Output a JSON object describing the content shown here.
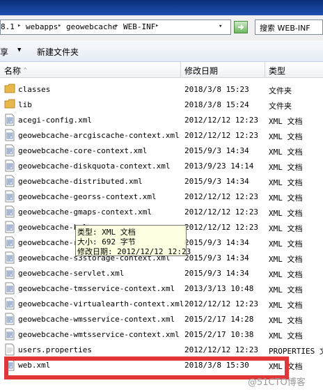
{
  "address": {
    "crumbs": [
      "8.1",
      "webapps",
      "geowebcache",
      "WEB-INF"
    ],
    "separator": "▸",
    "dropdown": "▾"
  },
  "search": {
    "placeholder": "搜索 WEB-INF"
  },
  "toolbar": {
    "share_label": "享",
    "share_caret": "▼",
    "new_folder_label": "新建文件夹"
  },
  "columns": {
    "name": "名称",
    "date": "修改日期",
    "type": "类型",
    "sort": "^"
  },
  "files": [
    {
      "name": "classes",
      "date": "2018/3/8 15:23",
      "type": "文件夹",
      "icon": "folder-icon"
    },
    {
      "name": "lib",
      "date": "2018/3/8 15:24",
      "type": "文件夹",
      "icon": "folder-icon"
    },
    {
      "name": "acegi-config.xml",
      "date": "2012/12/12 12:23",
      "type": "XML 文档",
      "icon": "xml-file-icon"
    },
    {
      "name": "geowebcache-arcgiscache-context.xml",
      "date": "2012/12/12 12:23",
      "type": "XML 文档",
      "icon": "xml-file-icon"
    },
    {
      "name": "geowebcache-core-context.xml",
      "date": "2015/9/3 14:34",
      "type": "XML 文档",
      "icon": "xml-file-icon"
    },
    {
      "name": "geowebcache-diskquota-context.xml",
      "date": "2013/9/23 14:14",
      "type": "XML 文档",
      "icon": "xml-file-icon"
    },
    {
      "name": "geowebcache-distributed.xml",
      "date": "2015/9/3 14:34",
      "type": "XML 文档",
      "icon": "xml-file-icon"
    },
    {
      "name": "geowebcache-georss-context.xml",
      "date": "2012/12/12 12:23",
      "type": "XML 文档",
      "icon": "xml-file-icon"
    },
    {
      "name": "geowebcache-gmaps-context.xml",
      "date": "2012/12/12 12:23",
      "type": "XML 文档",
      "icon": "xml-file-icon"
    },
    {
      "name": "geowebcache-kml",
      "date": "2012/12/12 12:23",
      "type": "XML 文档",
      "icon": "xml-file-icon"
    },
    {
      "name": "geowebcache-re",
      "date": "2015/9/3 14:34",
      "type": "XML 文档",
      "icon": "xml-file-icon"
    },
    {
      "name": "geowebcache-s3storage-context.xml",
      "date": "2015/9/3 14:34",
      "type": "XML 文档",
      "icon": "xml-file-icon"
    },
    {
      "name": "geowebcache-servlet.xml",
      "date": "2015/9/3 14:34",
      "type": "XML 文档",
      "icon": "xml-file-icon"
    },
    {
      "name": "geowebcache-tmsservice-context.xml",
      "date": "2013/3/13 10:48",
      "type": "XML 文档",
      "icon": "xml-file-icon"
    },
    {
      "name": "geowebcache-virtualearth-context.xml",
      "date": "2012/12/12 12:23",
      "type": "XML 文档",
      "icon": "xml-file-icon"
    },
    {
      "name": "geowebcache-wmsservice-context.xml",
      "date": "2015/2/17 14:28",
      "type": "XML 文档",
      "icon": "xml-file-icon"
    },
    {
      "name": "geowebcache-wmtsservice-context.xml",
      "date": "2015/2/17 10:38",
      "type": "XML 文档",
      "icon": "xml-file-icon"
    },
    {
      "name": "users.properties",
      "date": "2012/12/12 12:23",
      "type": "PROPERTIES 文",
      "icon": "properties-file-icon"
    },
    {
      "name": "web.xml",
      "date": "2018/3/8 15:30",
      "type": "XML 文档",
      "icon": "xml-file-icon"
    }
  ],
  "tooltip": {
    "type_line": "类型: XML 文档",
    "size_line": "大小: 692 字节",
    "date_line": "修改日期: 2012/12/12 12:23"
  },
  "watermark": "@51CTO博客",
  "colors": {
    "highlight": "#e23535",
    "tooltip_bg": "#ffffe1",
    "folder": "#e8b84a"
  }
}
